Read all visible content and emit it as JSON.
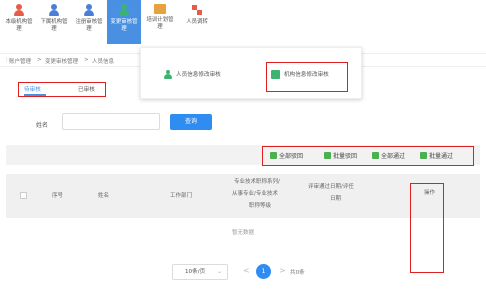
{
  "topnav": {
    "items": [
      {
        "label_lines": [
          "本级机构管",
          "理"
        ],
        "color": "#e85b4a"
      },
      {
        "label_lines": [
          "下属机构管",
          "理"
        ],
        "color": "#4a7fd6"
      },
      {
        "label_lines": [
          "注册审核管",
          "理"
        ],
        "color": "#4a7fd6"
      },
      {
        "label_lines": [
          "变更审核管",
          "理"
        ],
        "color": "#3cb371"
      },
      {
        "label_lines": [
          "培训计划管",
          "理"
        ],
        "color": "#e6a23c"
      },
      {
        "label_lines": [
          "人员调转"
        ],
        "color": "#e85b4a"
      }
    ],
    "active_bg": "#4a90e2"
  },
  "breadcrumb": {
    "items": [
      "账户管理",
      "变更审核管理",
      "人员信息"
    ],
    "separator": ">"
  },
  "submenu": {
    "items": [
      {
        "label": "人员信息修改审核",
        "icon": "user-icon"
      },
      {
        "label": "机构信息修改审核",
        "icon": "org-icon"
      }
    ]
  },
  "tabs": {
    "items": [
      "待审核",
      "已审核"
    ],
    "active_index": 0
  },
  "search": {
    "label": "姓名",
    "value": "",
    "placeholder": "",
    "button_label": "查询"
  },
  "actions": {
    "buttons": [
      {
        "label": "全部驳回",
        "icon": "reject-all-icon"
      },
      {
        "label": "批量驳回",
        "icon": "batch-reject-icon"
      },
      {
        "label": "全部通过",
        "icon": "approve-all-icon"
      },
      {
        "label": "批量通过",
        "icon": "batch-approve-icon"
      }
    ]
  },
  "table": {
    "headers": {
      "index": "序号",
      "name": "姓名",
      "dept": "工作部门",
      "title_lines": [
        "专业技术职称系列/",
        "从事专业/专业技术",
        "职称等级"
      ],
      "time_lines": [
        "评审通过日期/评任",
        "日期"
      ],
      "ops": "操作"
    },
    "empty_text": "暂无数据"
  },
  "pagination": {
    "page_size": "10条/页",
    "current_page": "1",
    "total": "共0条",
    "prev": "<",
    "next": ">"
  },
  "colors": {
    "primary": "#2f8cf0",
    "highlight": "#e02020",
    "green": "#4caf50"
  }
}
